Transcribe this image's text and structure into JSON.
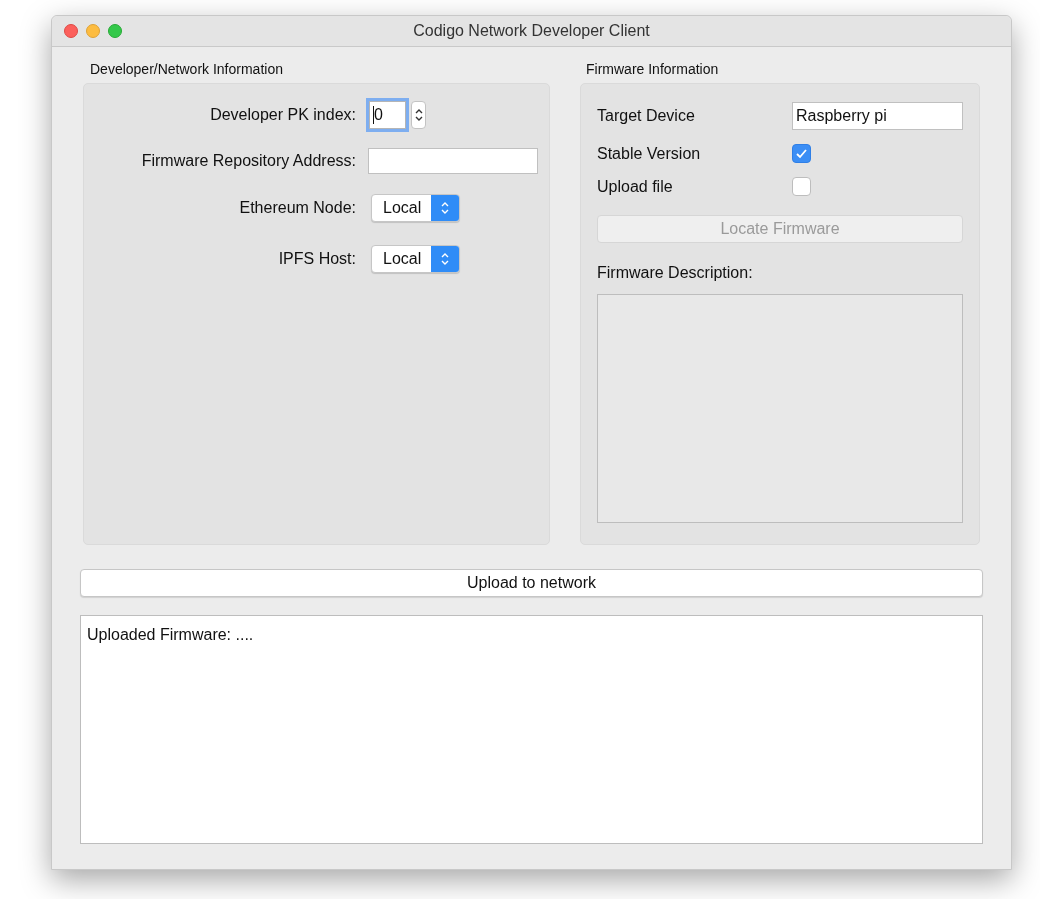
{
  "window": {
    "title": "Codigo Network Developer Client"
  },
  "developer_group": {
    "title": "Developer/Network Information",
    "fields": [
      {
        "kind": "spinbox",
        "label": "Developer PK index:",
        "value": "0",
        "focused": true
      },
      {
        "kind": "text",
        "label": "Firmware Repository Address:"
      },
      {
        "kind": "select",
        "label": "Ethereum Node:",
        "value": "Local"
      },
      {
        "kind": "select",
        "label": "IPFS Host:",
        "value": "Local"
      }
    ]
  },
  "firmware_group": {
    "title": "Firmware Information",
    "fields": [
      {
        "kind": "text",
        "label": "Target Device",
        "value": "Raspberry pi"
      },
      {
        "kind": "checkbox",
        "label": "Stable Version",
        "checked": true
      },
      {
        "kind": "checkbox",
        "label": "Upload file",
        "checked": false
      }
    ],
    "locate_button": {
      "label": "Locate Firmware",
      "disabled": true
    },
    "description_label": "Firmware Description:"
  },
  "upload_button": {
    "label": "Upload to network"
  },
  "log": {
    "text": "Uploaded Firmware: ...."
  }
}
